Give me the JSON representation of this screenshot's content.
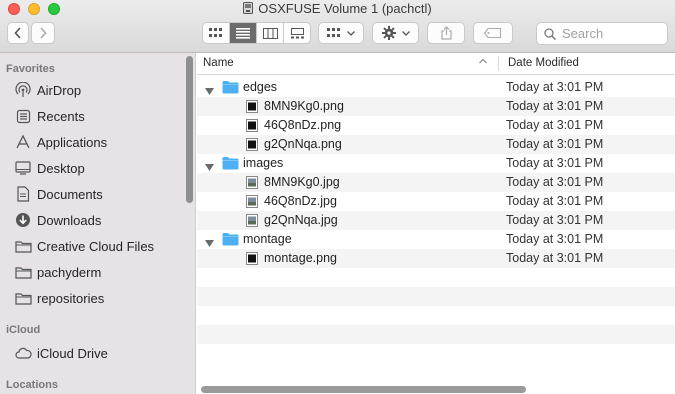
{
  "window": {
    "title": "OSXFUSE Volume 1 (pachctl)"
  },
  "toolbar": {
    "back_icon": "chevron-left-icon",
    "forward_icon": "chevron-right-icon",
    "view_icons": [
      "icon-view-icon",
      "list-view-icon",
      "column-view-icon",
      "gallery-view-icon"
    ],
    "active_view": "list",
    "search_placeholder": "Search"
  },
  "sidebar": {
    "sections": [
      {
        "header": "Favorites",
        "items": [
          {
            "label": "AirDrop",
            "icon": "airdrop-icon"
          },
          {
            "label": "Recents",
            "icon": "recents-icon"
          },
          {
            "label": "Applications",
            "icon": "applications-icon"
          },
          {
            "label": "Desktop",
            "icon": "desktop-icon"
          },
          {
            "label": "Documents",
            "icon": "documents-icon"
          },
          {
            "label": "Downloads",
            "icon": "downloads-icon"
          },
          {
            "label": "Creative Cloud Files",
            "icon": "folder-icon"
          },
          {
            "label": "pachyderm",
            "icon": "folder-icon"
          },
          {
            "label": "repositories",
            "icon": "folder-icon"
          }
        ]
      },
      {
        "header": "iCloud",
        "items": [
          {
            "label": "iCloud Drive",
            "icon": "cloud-icon"
          }
        ]
      },
      {
        "header": "Locations",
        "items": []
      }
    ]
  },
  "list": {
    "columns": {
      "name": "Name",
      "date": "Date Modified"
    },
    "rows": [
      {
        "name": "edges",
        "date": "Today at 3:01 PM",
        "kind": "folder",
        "expanded": true
      },
      {
        "name": "8MN9Kg0.png",
        "date": "Today at 3:01 PM",
        "kind": "file"
      },
      {
        "name": "46Q8nDz.png",
        "date": "Today at 3:01 PM",
        "kind": "file"
      },
      {
        "name": "g2QnNqa.png",
        "date": "Today at 3:01 PM",
        "kind": "file"
      },
      {
        "name": "images",
        "date": "Today at 3:01 PM",
        "kind": "folder",
        "expanded": true
      },
      {
        "name": "8MN9Kg0.jpg",
        "date": "Today at 3:01 PM",
        "kind": "file"
      },
      {
        "name": "46Q8nDz.jpg",
        "date": "Today at 3:01 PM",
        "kind": "file"
      },
      {
        "name": "g2QnNqa.jpg",
        "date": "Today at 3:01 PM",
        "kind": "file"
      },
      {
        "name": "montage",
        "date": "Today at 3:01 PM",
        "kind": "folder",
        "expanded": true
      },
      {
        "name": "montage.png",
        "date": "Today at 3:01 PM",
        "kind": "file"
      }
    ]
  },
  "colors": {
    "sidebar_bg": "#e6e2e6",
    "folder": "#4db0f2",
    "row_alt": "#f4f4f5"
  }
}
